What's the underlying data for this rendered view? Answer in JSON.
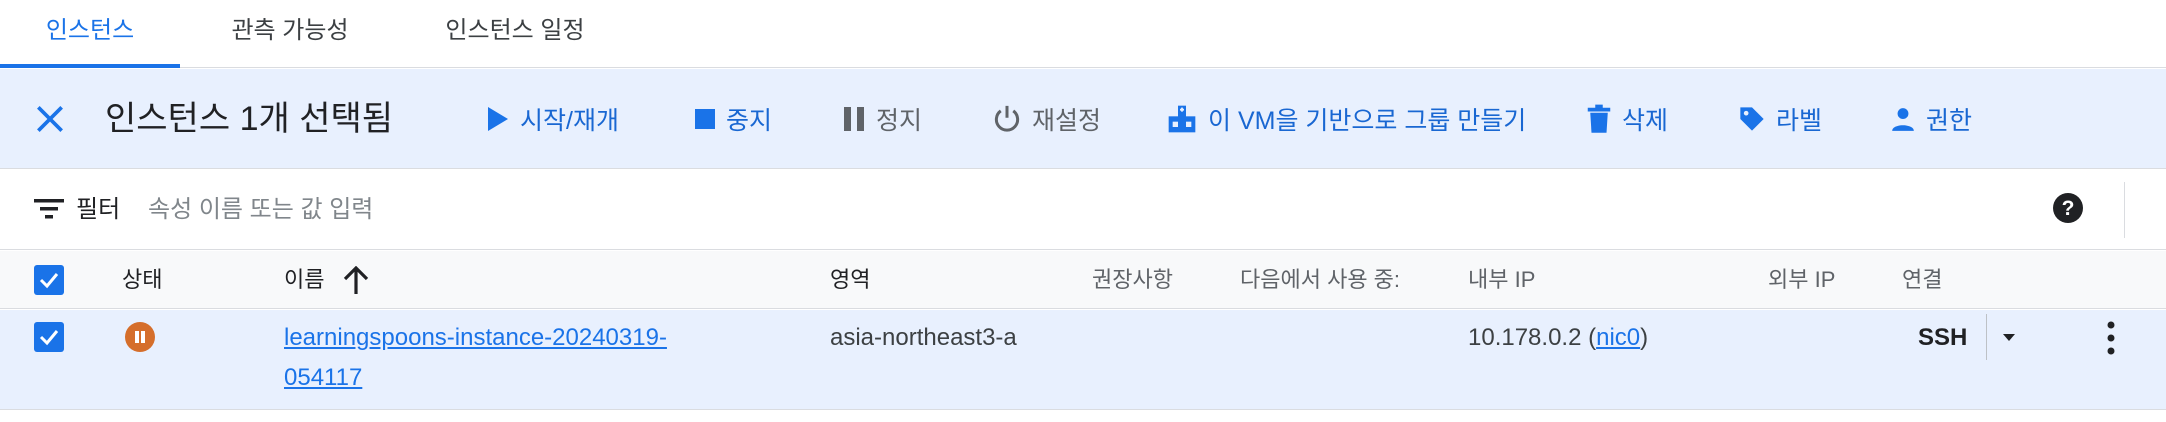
{
  "tabs": [
    {
      "label": "인스턴스",
      "active": true
    },
    {
      "label": "관측 가능성",
      "active": false
    },
    {
      "label": "인스턴스 일정",
      "active": false
    }
  ],
  "action_bar": {
    "selected_text": "인스턴스 1개 선택됨",
    "actions": {
      "start": "시작/재개",
      "stop": "중지",
      "suspend": "정지",
      "reset": "재설정",
      "create_group": "이 VM을 기반으로 그룹 만들기",
      "delete": "삭제",
      "labels": "라벨",
      "permissions": "권한"
    }
  },
  "filter": {
    "label": "필터",
    "placeholder": "속성 이름 또는 값 입력"
  },
  "table": {
    "columns": {
      "status": "상태",
      "name": "이름",
      "zone": "영역",
      "recommendations": "권장사항",
      "in_use_by": "다음에서 사용 중:",
      "internal_ip": "내부 IP",
      "external_ip": "외부 IP",
      "connect": "연결"
    },
    "rows": [
      {
        "status": "suspended",
        "name": "learningspoons-instance-20240319-054117",
        "zone": "asia-northeast3-a",
        "internal_ip": "10.178.0.2",
        "nic": "nic0",
        "connect": "SSH"
      }
    ]
  },
  "colors": {
    "accent": "#1a73e8",
    "selected_bg": "#e8f0fe",
    "status_suspended": "#d56e2b"
  }
}
